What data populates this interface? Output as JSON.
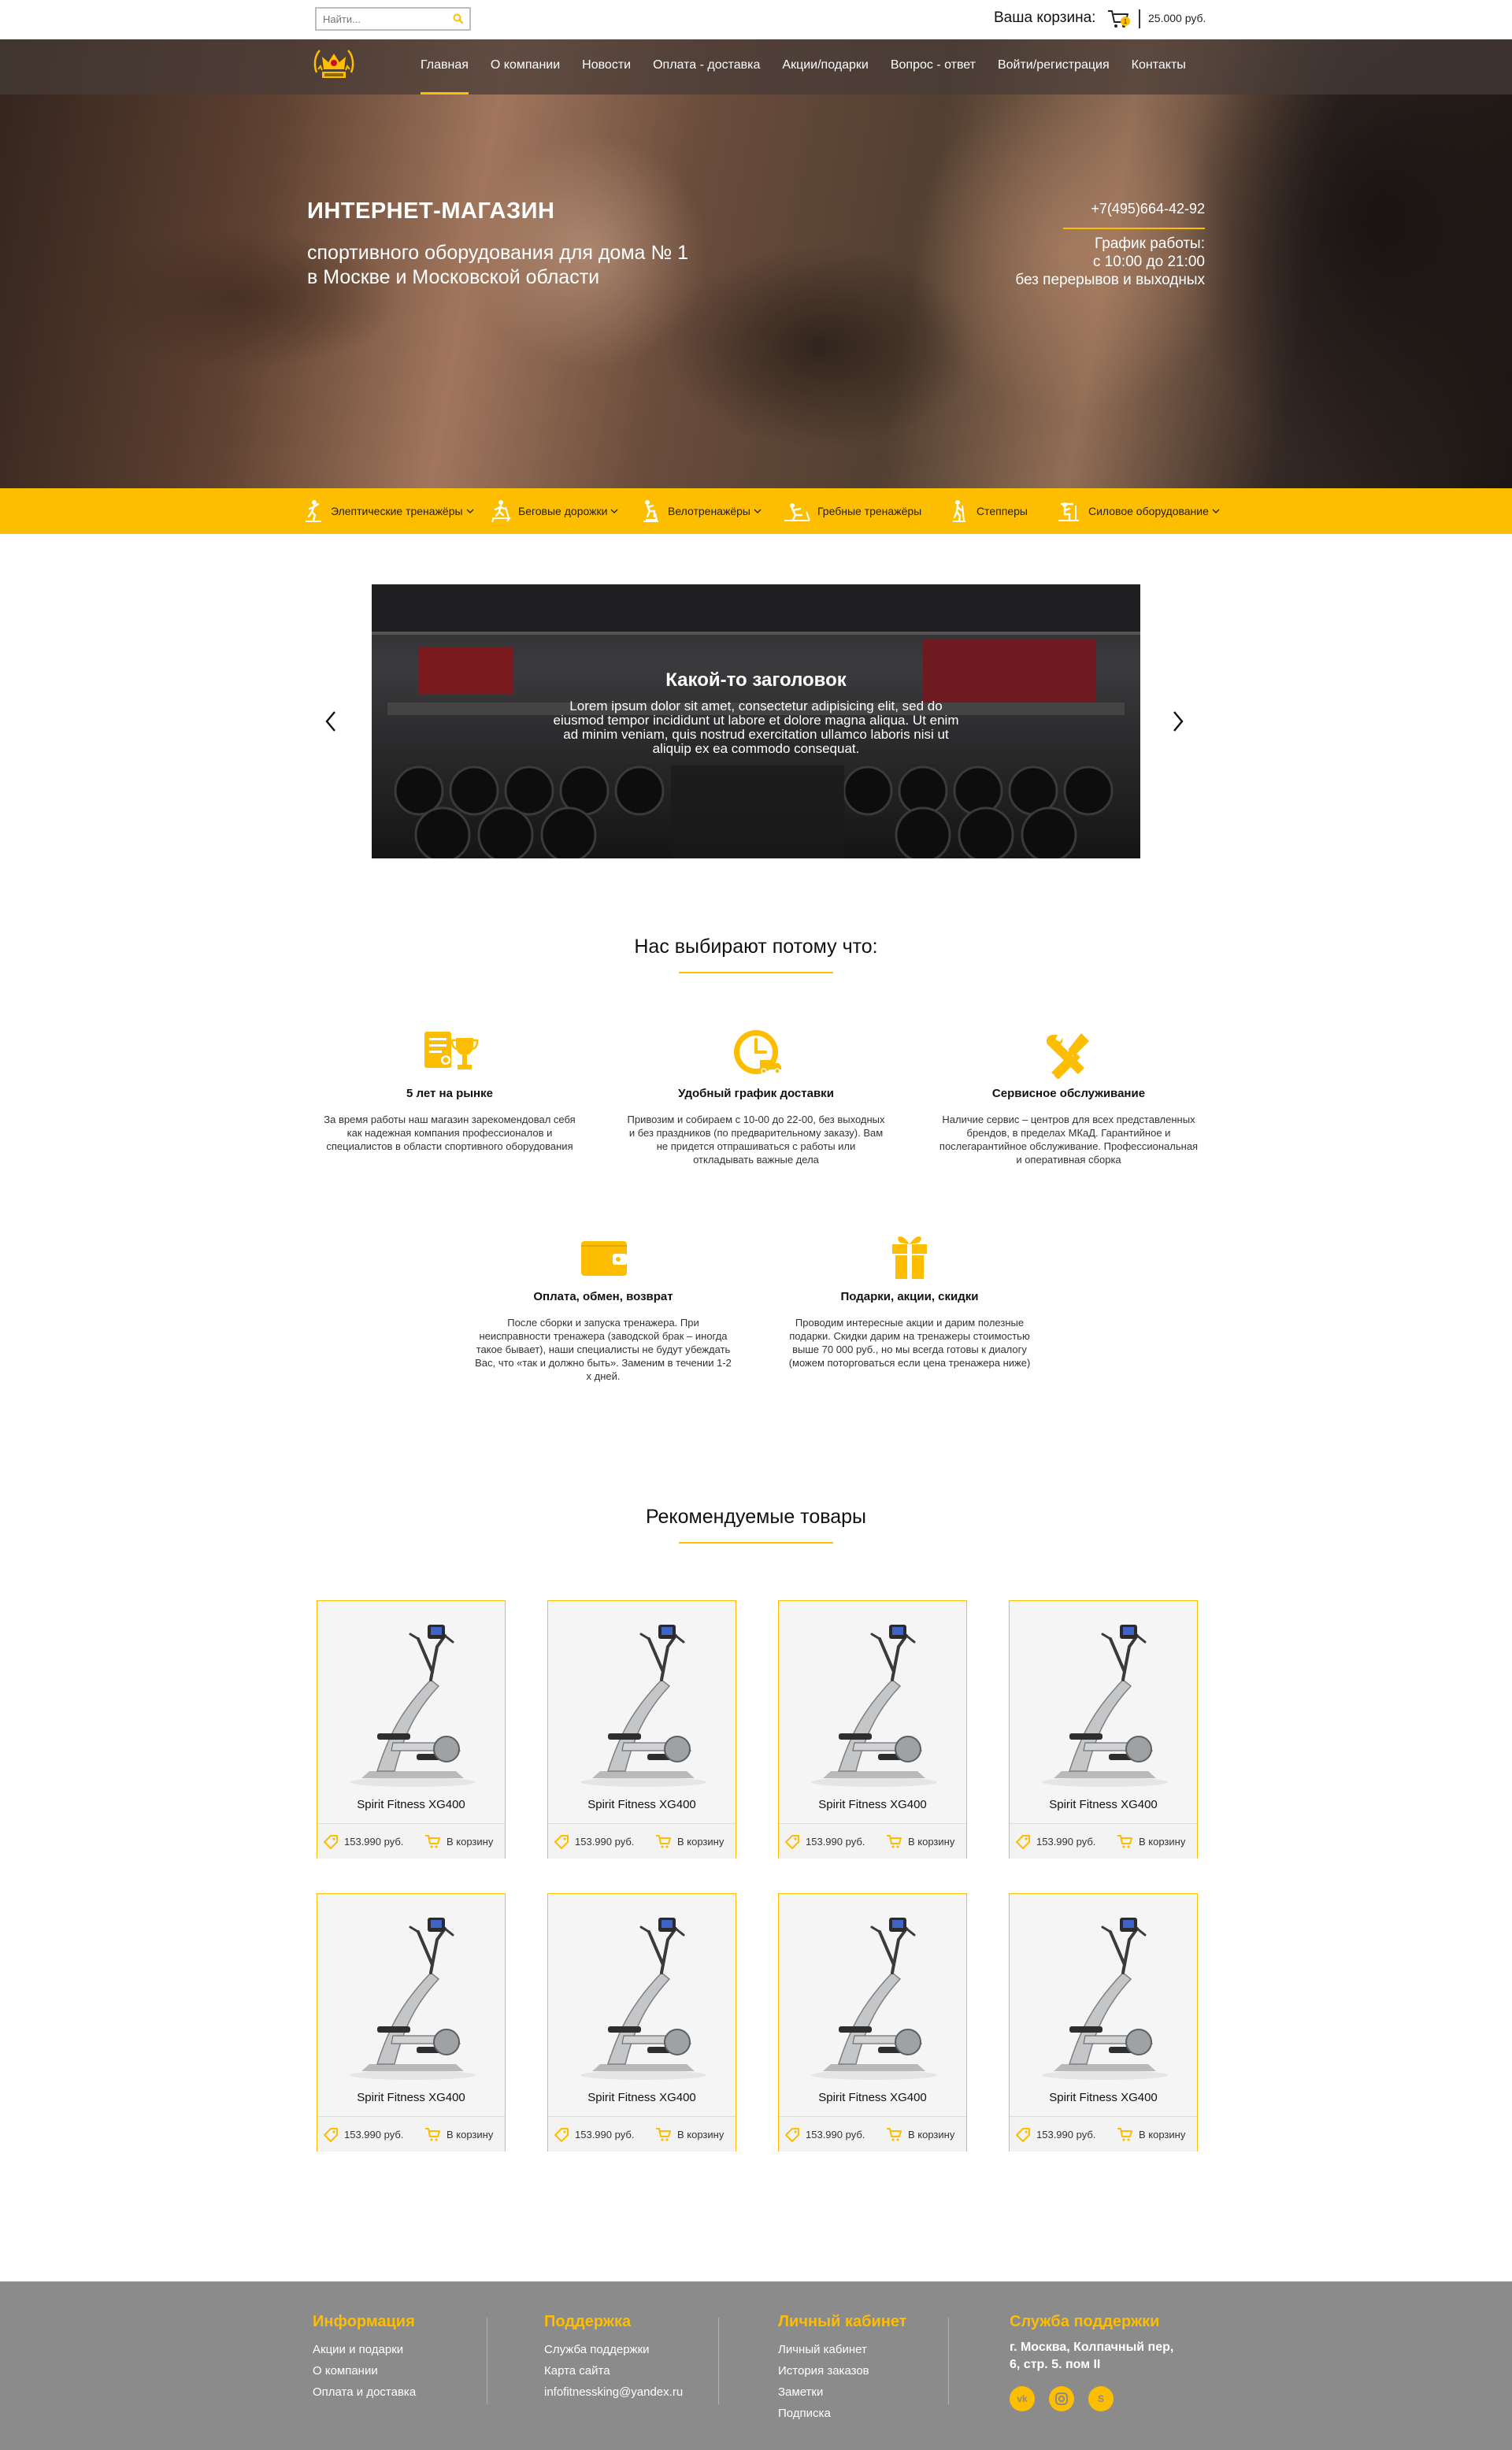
{
  "search": {
    "placeholder": "Найти..."
  },
  "cart": {
    "label": "Ваша корзина:",
    "count": "1",
    "total": "25.000 руб."
  },
  "nav": {
    "items": [
      "Главная",
      "О компании",
      "Новости",
      "Оплата - доставка",
      "Акции/подарки",
      "Вопрос - ответ",
      "Войти/регистрация",
      "Контакты"
    ],
    "active": "Главная"
  },
  "hero": {
    "title": "ИНТЕРНЕТ-МАГАЗИН",
    "subtitle_line1": "спортивного оборудования для дома № 1",
    "subtitle_line2": "в Москве и Московской области",
    "phone": "+7(495)664-42-92",
    "hours_line1": "График работы:",
    "hours_line2": "с 10:00 до 21:00",
    "hours_line3": "без перерывов и выходных"
  },
  "categories": [
    {
      "label": "Элептические тренажёры",
      "icon": "elliptical-icon",
      "dropdown": true
    },
    {
      "label": "Беговые дорожки",
      "icon": "treadmill-icon",
      "dropdown": true
    },
    {
      "label": "Велотренажёры",
      "icon": "bike-icon",
      "dropdown": true
    },
    {
      "label": "Гребные тренажёры",
      "icon": "rower-icon",
      "dropdown": false
    },
    {
      "label": "Степперы",
      "icon": "stepper-icon",
      "dropdown": false
    },
    {
      "label": "Силовое оборудование",
      "icon": "strength-icon",
      "dropdown": true
    }
  ],
  "slider": {
    "title": "Какой-то заголовок",
    "text": "Lorem ipsum dolor sit amet, consectetur adipisicing elit, sed do eiusmod tempor incididunt ut labore et dolore magna aliqua. Ut enim ad minim veniam, quis nostrud exercitation ullamco laboris nisi ut aliquip ex ea commodo consequat."
  },
  "why": {
    "title": "Нас выбирают потому что:",
    "items": [
      {
        "title": "5 лет на рынке",
        "text": "За время работы наш магазин зарекомендовал себя как надежная компания профессионалов и специалистов в области спортивного оборудования",
        "icon": "certificate-trophy-icon"
      },
      {
        "title": "Удобный график доставки",
        "text": "Привозим и собираем с 10-00 до 22-00, без выходных и без праздников (по предварительному заказу). Вам не придется отпрашиваться с работы или откладывать важные дела",
        "icon": "clock-truck-icon"
      },
      {
        "title": "Сервисное обслуживание",
        "text": "Наличие сервис – центров для всех представленных брендов, в пределах МКаД. Гарантийное и послегарантийное обслуживание. Профессиональная и оперативная сборка",
        "icon": "wrench-screwdriver-icon"
      },
      {
        "title": "Оплата, обмен, возврат",
        "text": "После сборки и запуска тренажера. При неисправности тренажера (заводской брак – иногда такое бывает), наши специалисты не будут убеждать Вас, что «так и должно быть». Заменим в течении 1-2 х дней.",
        "icon": "wallet-icon"
      },
      {
        "title": "Подарки, акции, скидки",
        "text": "Проводим интересные акции и дарим полезные подарки. Скидки дарим на тренажеры стоимостью выше 70 000 руб., но мы всегда готовы к диалогу (можем поторговаться если цена тренажера ниже)",
        "icon": "gift-icon"
      }
    ]
  },
  "products": {
    "title": "Рекомендуемые товары",
    "items": [
      {
        "name": "Spirit Fitness XG400",
        "price": "153.990 руб.",
        "button": "В корзину"
      },
      {
        "name": "Spirit Fitness XG400",
        "price": "153.990 руб.",
        "button": "В корзину"
      },
      {
        "name": "Spirit Fitness XG400",
        "price": "153.990 руб.",
        "button": "В корзину"
      },
      {
        "name": "Spirit Fitness XG400",
        "price": "153.990 руб.",
        "button": "В корзину"
      },
      {
        "name": "Spirit Fitness XG400",
        "price": "153.990 руб.",
        "button": "В корзину"
      },
      {
        "name": "Spirit Fitness XG400",
        "price": "153.990 руб.",
        "button": "В корзину"
      },
      {
        "name": "Spirit Fitness XG400",
        "price": "153.990 руб.",
        "button": "В корзину"
      },
      {
        "name": "Spirit Fitness XG400",
        "price": "153.990 руб.",
        "button": "В корзину"
      }
    ]
  },
  "footer": {
    "info": {
      "title": "Информация",
      "links": [
        "Акции и подарки",
        "О компании",
        "Оплата и доставка"
      ]
    },
    "support": {
      "title": "Поддержка",
      "links": [
        "Служба поддержки",
        "Карта сайта",
        "infofitnessking@yandex.ru"
      ]
    },
    "account": {
      "title": "Личный кабинет",
      "links": [
        "Личный кабинет",
        "История заказов",
        "Заметки",
        "Подписка"
      ]
    },
    "service": {
      "title": "Служба поддержки",
      "address_line1": "г. Москва, Колпачный пер,",
      "address_line2": "6, стр. 5. пом II",
      "social": [
        "vk-icon",
        "instagram-icon",
        "skype-icon"
      ]
    }
  },
  "colors": {
    "accent": "#fdbd00",
    "footer_bg": "#8b8b8b",
    "nav_bg": "#463c37"
  }
}
